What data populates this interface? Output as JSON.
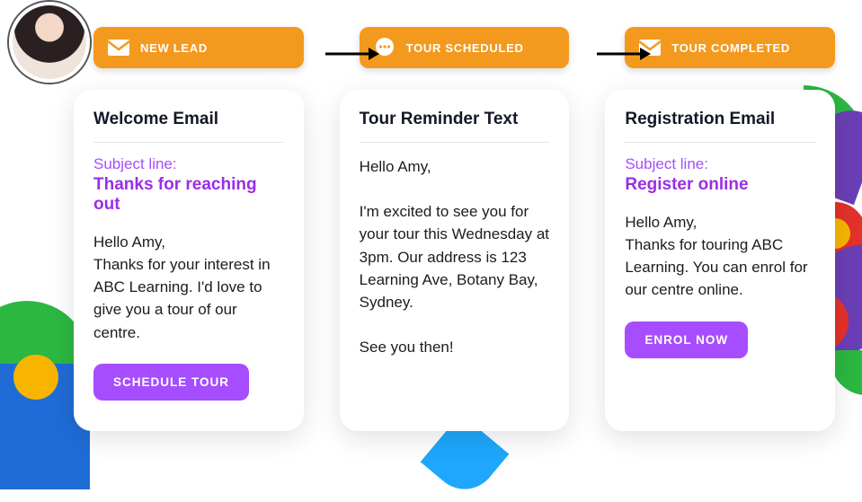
{
  "stages": [
    {
      "icon": "mail-icon",
      "label": "NEW LEAD"
    },
    {
      "icon": "chat-icon",
      "label": "TOUR SCHEDULED"
    },
    {
      "icon": "mail-icon",
      "label": "TOUR COMPLETED"
    }
  ],
  "cards": [
    {
      "title": "Welcome Email",
      "subject_label": "Subject line:",
      "subject": "Thanks for reaching out",
      "body": "Hello Amy,\nThanks for your interest in ABC Learning. I'd love to give you a tour of our centre.",
      "cta": "SCHEDULE TOUR"
    },
    {
      "title": "Tour Reminder Text",
      "body": "Hello Amy,\n\nI'm excited to see you for your tour this Wednesday at 3pm. Our address is 123 Learning Ave, Botany Bay, Sydney.\n\nSee you then!"
    },
    {
      "title": "Registration Email",
      "subject_label": "Subject line:",
      "subject": "Register online",
      "body": "Hello Amy,\nThanks for touring ABC Learning. You can enrol for our centre online.",
      "cta": "ENROL NOW"
    }
  ],
  "colors": {
    "stage_bg": "#f39a1e",
    "accent_purple": "#a64dff",
    "subject_purple": "#9a2ee6"
  }
}
